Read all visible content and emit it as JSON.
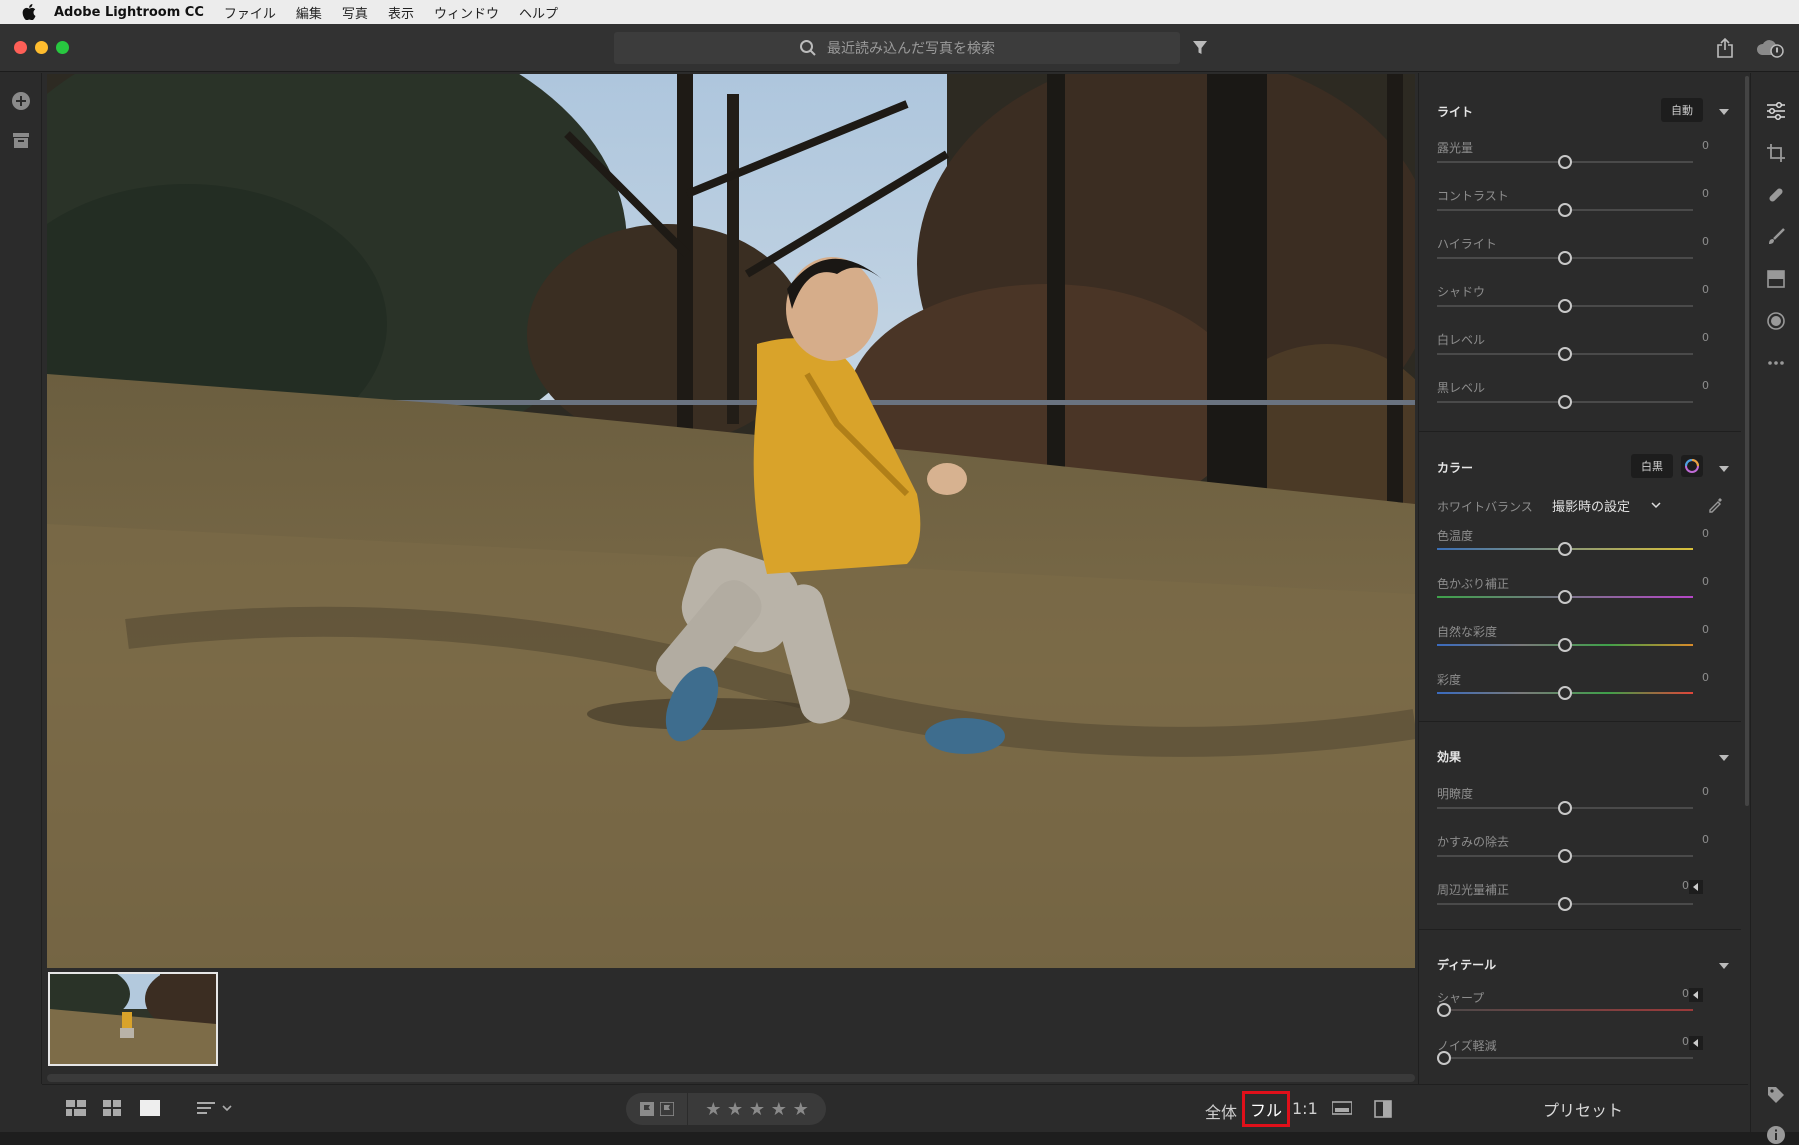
{
  "menubar": {
    "app_name": "Adobe Lightroom CC",
    "items": [
      "ファイル",
      "編集",
      "写真",
      "表示",
      "ウィンドウ",
      "ヘルプ"
    ]
  },
  "search": {
    "placeholder": "最近読み込んだ写真を検索"
  },
  "panel": {
    "light": {
      "title": "ライト",
      "auto_label": "自動",
      "sliders": [
        {
          "label": "露光量",
          "value": "0",
          "position": 0.5
        },
        {
          "label": "コントラスト",
          "value": "0",
          "position": 0.5
        },
        {
          "label": "ハイライト",
          "value": "0",
          "position": 0.5
        },
        {
          "label": "シャドウ",
          "value": "0",
          "position": 0.5
        },
        {
          "label": "白レベル",
          "value": "0",
          "position": 0.5
        },
        {
          "label": "黒レベル",
          "value": "0",
          "position": 0.5
        }
      ]
    },
    "color": {
      "title": "カラー",
      "bw_label": "白黒",
      "wb_label": "ホワイトバランス",
      "wb_value": "撮影時の設定",
      "sliders": [
        {
          "label": "色温度",
          "value": "0",
          "position": 0.5
        },
        {
          "label": "色かぶり補正",
          "value": "0",
          "position": 0.5
        },
        {
          "label": "自然な彩度",
          "value": "0",
          "position": 0.5
        },
        {
          "label": "彩度",
          "value": "0",
          "position": 0.5
        }
      ]
    },
    "effects": {
      "title": "効果",
      "sliders": [
        {
          "label": "明瞭度",
          "value": "0",
          "position": 0.5
        },
        {
          "label": "かすみの除去",
          "value": "0",
          "position": 0.5
        },
        {
          "label": "周辺光量補正",
          "value": "0",
          "position": 0.5
        }
      ]
    },
    "detail": {
      "title": "ディテール",
      "sliders": [
        {
          "label": "シャープ",
          "value": "0",
          "position": 0.0
        },
        {
          "label": "ノイズ軽減",
          "value": "0",
          "position": 0.0
        }
      ]
    },
    "presets_label": "プリセット"
  },
  "bottombar": {
    "stars": "★ ★ ★ ★ ★",
    "zoom_fit": "全体",
    "zoom_fill": "フル",
    "zoom_one": "1:1"
  },
  "colors": {
    "accent_highlight": "#e0101a",
    "jacket": "#d9a32a"
  }
}
